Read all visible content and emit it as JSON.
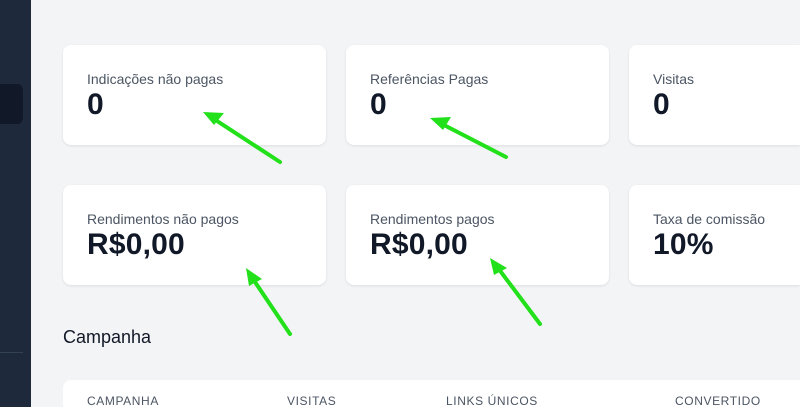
{
  "cards": [
    {
      "label": "Indicações não pagas",
      "value": "0"
    },
    {
      "label": "Referências Pagas",
      "value": "0"
    },
    {
      "label": "Visitas",
      "value": "0"
    },
    {
      "label": "Rendimentos não pagos",
      "value": "R$0,00"
    },
    {
      "label": "Rendimentos pagos",
      "value": "R$0,00"
    },
    {
      "label": "Taxa de comissão",
      "value": "10%"
    }
  ],
  "section": {
    "title": "Campanha"
  },
  "table": {
    "columns": [
      "CAMPANHA",
      "VISITAS",
      "LINKS ÚNICOS",
      "CONVERTIDO"
    ]
  },
  "colors": {
    "sidebar": "#1e293b",
    "background": "#f3f4f6",
    "annotation_arrow": "#22e01a"
  }
}
